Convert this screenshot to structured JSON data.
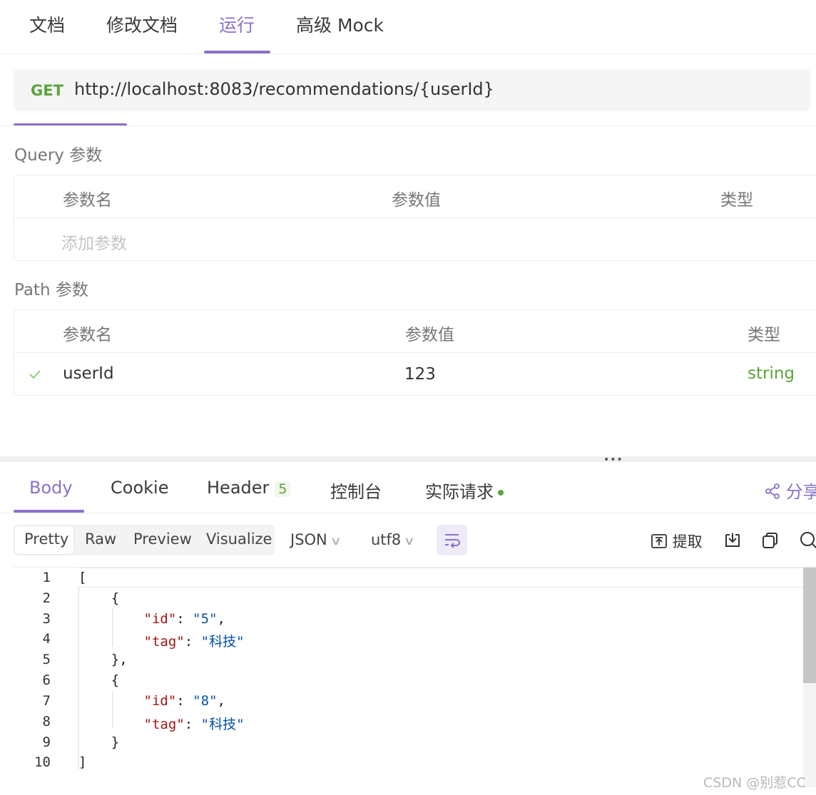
{
  "top_tabs": [
    {
      "label": "文档"
    },
    {
      "label": "修改文档"
    },
    {
      "label": "运行"
    },
    {
      "label": "高级 Mock"
    }
  ],
  "request": {
    "method": "GET",
    "url": "http://localhost:8083/recommendations/{userId}"
  },
  "query": {
    "title": "Query 参数",
    "headers": [
      "参数名",
      "参数值",
      "类型"
    ],
    "add_placeholder": "添加参数"
  },
  "path": {
    "title": "Path 参数",
    "headers": [
      "参数名",
      "参数值",
      "类型"
    ],
    "rows": [
      {
        "name": "userId",
        "value": "123",
        "type": "string"
      }
    ]
  },
  "response_tabs": {
    "body": "Body",
    "cookie": "Cookie",
    "header": "Header",
    "header_count": "5",
    "console": "控制台",
    "actual": "实际请求",
    "share": "分享"
  },
  "format": {
    "options": [
      "Pretty",
      "Raw",
      "Preview",
      "Visualize"
    ],
    "type": "JSON",
    "encoding": "utf8",
    "extract": "提取"
  },
  "code": {
    "line_numbers": [
      "1",
      "2",
      "3",
      "4",
      "5",
      "6",
      "7",
      "8",
      "9",
      "10"
    ],
    "items": [
      {
        "id": "5",
        "tag": "科技"
      },
      {
        "id": "8",
        "tag": "科技"
      }
    ]
  },
  "watermark": "CSDN @别惹CC",
  "colors": {
    "accent": "#8a72c9",
    "method_get": "#5aa43c",
    "type_string": "#5aa43c"
  },
  "icons": [
    "check-icon",
    "share-icon",
    "chevron-down-icon",
    "wrap-icon",
    "extract-icon",
    "download-icon",
    "copy-icon",
    "search-icon"
  ]
}
